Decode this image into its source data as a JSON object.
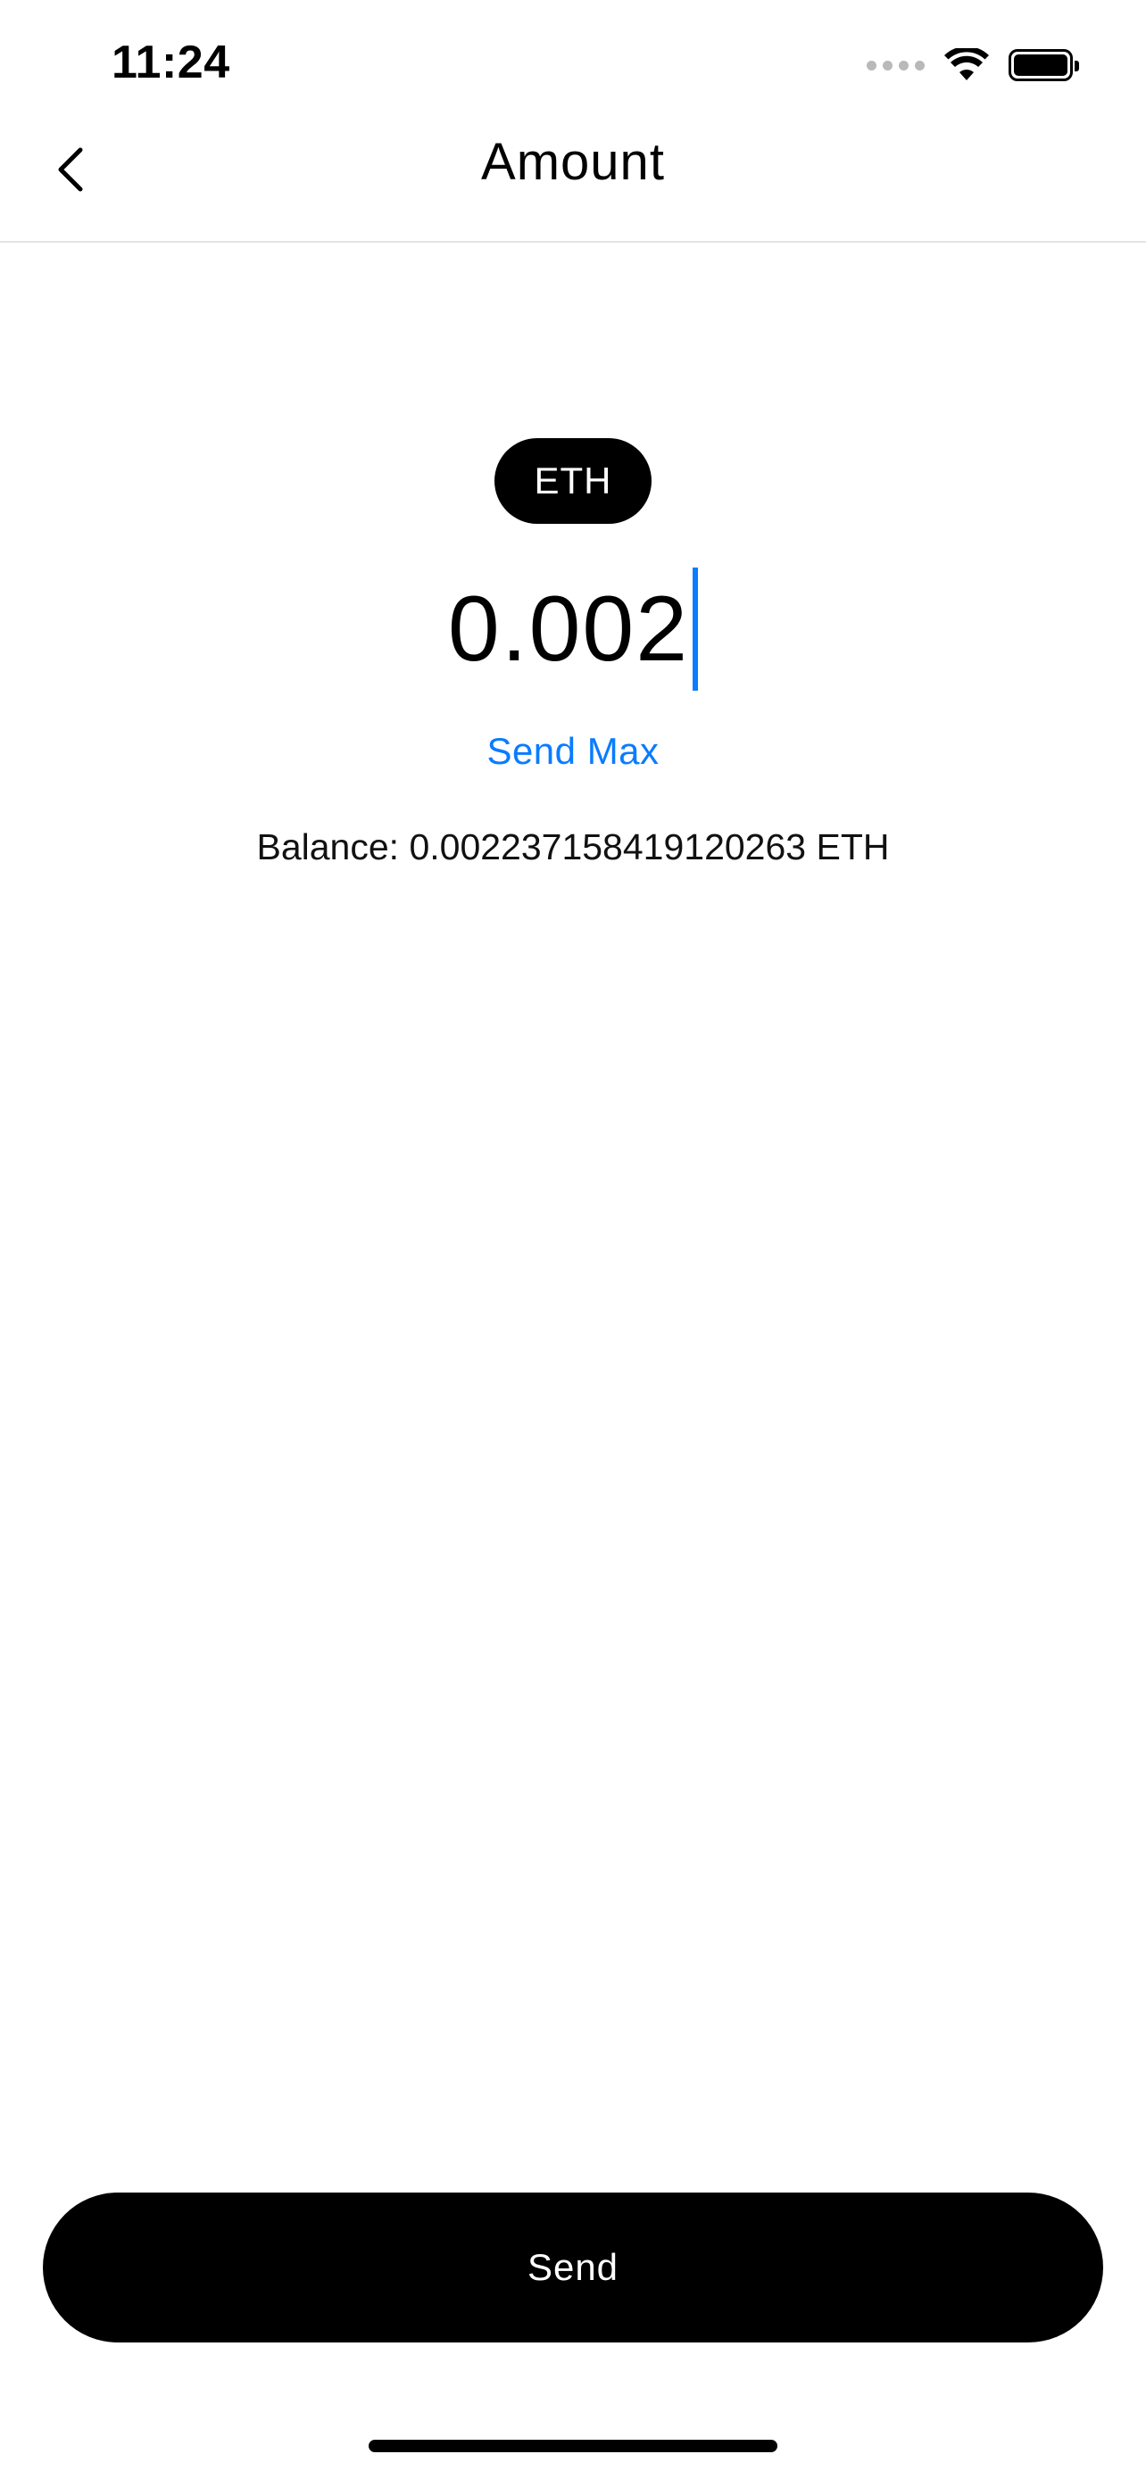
{
  "status_bar": {
    "time": "11:24",
    "icons": [
      "cellular-signal-icon",
      "wifi-icon",
      "battery-icon"
    ]
  },
  "nav": {
    "title": "Amount",
    "back_icon": "chevron-left-icon"
  },
  "token": {
    "symbol": "ETH"
  },
  "amount": {
    "value": "0.002"
  },
  "send_max": {
    "label": "Send Max"
  },
  "balance": {
    "text": "Balance: 0.002237158419120263 ETH"
  },
  "footer": {
    "send_label": "Send"
  },
  "colors": {
    "accent": "#0a7cff",
    "primary_button": "#000000",
    "background": "#ffffff"
  }
}
